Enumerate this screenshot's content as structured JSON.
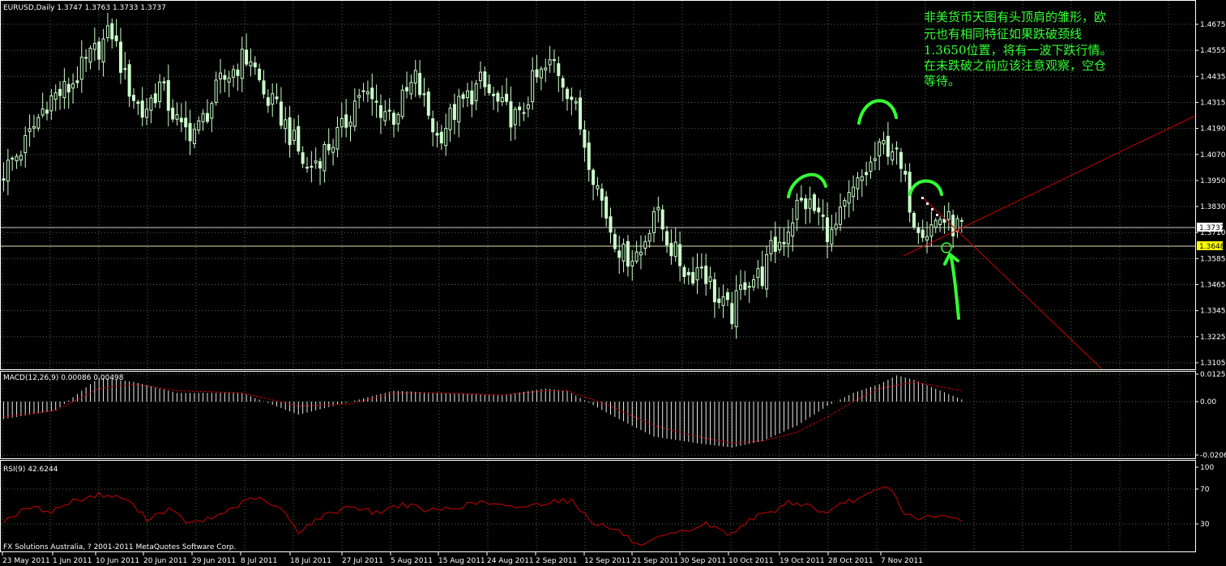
{
  "window": {
    "symbol_header": "EURUSD,Daily  1.3747 1.3763 1.3733 1.3737",
    "broker_footer": "FX Solutions Australia, ? 2001-2011 MetaQuotes Software Corp."
  },
  "annotation": {
    "lines": [
      "非美货币天图有头顶肩的雏形，欧",
      "元也有相同特征如果跌破颈线",
      "1.3650位置，将有一波下跌行情。",
      "在未跌破之前应该注意观察，空仓",
      "等待。"
    ]
  },
  "colors": {
    "background": "#000000",
    "grid": "#4a6e4a",
    "candle": "#ccffcc",
    "annotation": "#33ff33",
    "trendline": "#cc0000",
    "hline": "#cccccc",
    "macd_signal": "#cc0000",
    "rsi_line": "#cc0000",
    "price_tag_current": "#ffffff",
    "price_tag_level": "#ffff00"
  },
  "chart_data": [
    {
      "type": "candlestick",
      "title": "EURUSD,Daily",
      "ylim": [
        3.105,
        1.4675
      ],
      "y_ticks": [
        "1.4675",
        "1.4555",
        "1.4435",
        "1.4315",
        "1.4190",
        "1.4070",
        "1.3950",
        "1.3830",
        "1.3710",
        "1.3585",
        "1.3465",
        "1.3345",
        "1.3225",
        "1.3105"
      ],
      "x_tick_labels": [
        "23 May 2011",
        "1 Jun 2011",
        "10 Jun 2011",
        "20 Jun 2011",
        "29 Jun 2011",
        "8 Jul 2011",
        "18 Jul 2011",
        "27 Jul 2011",
        "5 Aug 2011",
        "15 Aug 2011",
        "24 Aug 2011",
        "2 Sep 2011",
        "12 Sep 2011",
        "21 Sep 2011",
        "30 Sep 2011",
        "10 Oct 2011",
        "19 Oct 2011",
        "28 Oct 2011",
        "7 Nov 2011"
      ],
      "price_tags": {
        "current": "1.3737",
        "level": "1.3648"
      },
      "close_path": [
        [
          0,
          1.399
        ],
        [
          5,
          1.412
        ],
        [
          10,
          1.432
        ],
        [
          15,
          1.438
        ],
        [
          20,
          1.452
        ],
        [
          25,
          1.464
        ],
        [
          28,
          1.442
        ],
        [
          32,
          1.426
        ],
        [
          36,
          1.439
        ],
        [
          41,
          1.418
        ],
        [
          45,
          1.419
        ],
        [
          50,
          1.44
        ],
        [
          55,
          1.451
        ],
        [
          57,
          1.452
        ],
        [
          60,
          1.435
        ],
        [
          64,
          1.425
        ],
        [
          70,
          1.4
        ],
        [
          74,
          1.409
        ],
        [
          78,
          1.418
        ],
        [
          82,
          1.436
        ],
        [
          86,
          1.43
        ],
        [
          90,
          1.425
        ],
        [
          95,
          1.442
        ],
        [
          100,
          1.415
        ],
        [
          104,
          1.427
        ],
        [
          110,
          1.44
        ],
        [
          115,
          1.428
        ],
        [
          119,
          1.423
        ],
        [
          122,
          1.44
        ],
        [
          127,
          1.45
        ],
        [
          131,
          1.434
        ],
        [
          137,
          1.392
        ],
        [
          140,
          1.373
        ],
        [
          143,
          1.36
        ],
        [
          147,
          1.362
        ],
        [
          150,
          1.382
        ],
        [
          154,
          1.364
        ],
        [
          158,
          1.351
        ],
        [
          161,
          1.356
        ],
        [
          165,
          1.338
        ],
        [
          168,
          1.333
        ],
        [
          171,
          1.349
        ],
        [
          175,
          1.351
        ],
        [
          177,
          1.362
        ],
        [
          180,
          1.369
        ],
        [
          183,
          1.383
        ],
        [
          185,
          1.385
        ],
        [
          188,
          1.379
        ],
        [
          191,
          1.369
        ],
        [
          195,
          1.386
        ],
        [
          198,
          1.396
        ],
        [
          203,
          1.411
        ],
        [
          205,
          1.411
        ],
        [
          208,
          1.393
        ],
        [
          210,
          1.378
        ],
        [
          213,
          1.372
        ],
        [
          216,
          1.378
        ],
        [
          219,
          1.374
        ],
        [
          221,
          1.373
        ]
      ]
    },
    {
      "type": "bar",
      "title": "MACD(12,26,9) 0.00086 0.00498",
      "y_ticks": [
        "0.01258",
        "0.00",
        "-0.0206"
      ],
      "histogram_path": [
        [
          0,
          -0.008
        ],
        [
          12,
          -0.004
        ],
        [
          22,
          0.011
        ],
        [
          30,
          0.009
        ],
        [
          40,
          0.004
        ],
        [
          55,
          0.004
        ],
        [
          68,
          -0.006
        ],
        [
          80,
          0.0
        ],
        [
          90,
          0.005
        ],
        [
          100,
          0.004
        ],
        [
          115,
          0.003
        ],
        [
          125,
          0.006
        ],
        [
          130,
          0.005
        ],
        [
          140,
          -0.006
        ],
        [
          150,
          -0.016
        ],
        [
          160,
          -0.019
        ],
        [
          168,
          -0.021
        ],
        [
          175,
          -0.018
        ],
        [
          183,
          -0.011
        ],
        [
          190,
          -0.002
        ],
        [
          196,
          0.004
        ],
        [
          202,
          0.008
        ],
        [
          206,
          0.012
        ],
        [
          210,
          0.01
        ],
        [
          221,
          0.001
        ]
      ],
      "signal_path": [
        [
          0,
          -0.007
        ],
        [
          12,
          -0.004
        ],
        [
          22,
          0.006
        ],
        [
          30,
          0.008
        ],
        [
          40,
          0.005
        ],
        [
          55,
          0.004
        ],
        [
          68,
          -0.002
        ],
        [
          80,
          -0.001
        ],
        [
          90,
          0.004
        ],
        [
          100,
          0.004
        ],
        [
          115,
          0.003
        ],
        [
          125,
          0.005
        ],
        [
          130,
          0.005
        ],
        [
          140,
          -0.002
        ],
        [
          150,
          -0.011
        ],
        [
          160,
          -0.016
        ],
        [
          168,
          -0.019
        ],
        [
          175,
          -0.018
        ],
        [
          183,
          -0.014
        ],
        [
          190,
          -0.007
        ],
        [
          196,
          0.0
        ],
        [
          202,
          0.006
        ],
        [
          210,
          0.009
        ],
        [
          221,
          0.005
        ]
      ]
    },
    {
      "type": "line",
      "title": "RSI(9) 42.6244",
      "y_ticks": [
        "100",
        "70",
        "30",
        "0"
      ],
      "ylim": [
        0,
        100
      ],
      "levels": [
        70,
        30
      ],
      "rsi_path": [
        [
          0,
          42
        ],
        [
          6,
          56
        ],
        [
          11,
          52
        ],
        [
          16,
          63
        ],
        [
          22,
          70
        ],
        [
          28,
          66
        ],
        [
          33,
          44
        ],
        [
          38,
          54
        ],
        [
          43,
          38
        ],
        [
          48,
          44
        ],
        [
          53,
          56
        ],
        [
          58,
          67
        ],
        [
          64,
          54
        ],
        [
          68,
          30
        ],
        [
          73,
          45
        ],
        [
          80,
          58
        ],
        [
          86,
          50
        ],
        [
          92,
          60
        ],
        [
          98,
          52
        ],
        [
          104,
          56
        ],
        [
          110,
          62
        ],
        [
          116,
          56
        ],
        [
          122,
          58
        ],
        [
          127,
          64
        ],
        [
          131,
          63
        ],
        [
          136,
          40
        ],
        [
          142,
          30
        ],
        [
          147,
          12
        ],
        [
          152,
          24
        ],
        [
          156,
          28
        ],
        [
          162,
          38
        ],
        [
          168,
          26
        ],
        [
          172,
          44
        ],
        [
          177,
          50
        ],
        [
          181,
          62
        ],
        [
          186,
          58
        ],
        [
          190,
          48
        ],
        [
          194,
          62
        ],
        [
          198,
          66
        ],
        [
          203,
          78
        ],
        [
          205,
          74
        ],
        [
          208,
          48
        ],
        [
          212,
          44
        ],
        [
          216,
          46
        ],
        [
          221,
          43
        ]
      ]
    }
  ]
}
